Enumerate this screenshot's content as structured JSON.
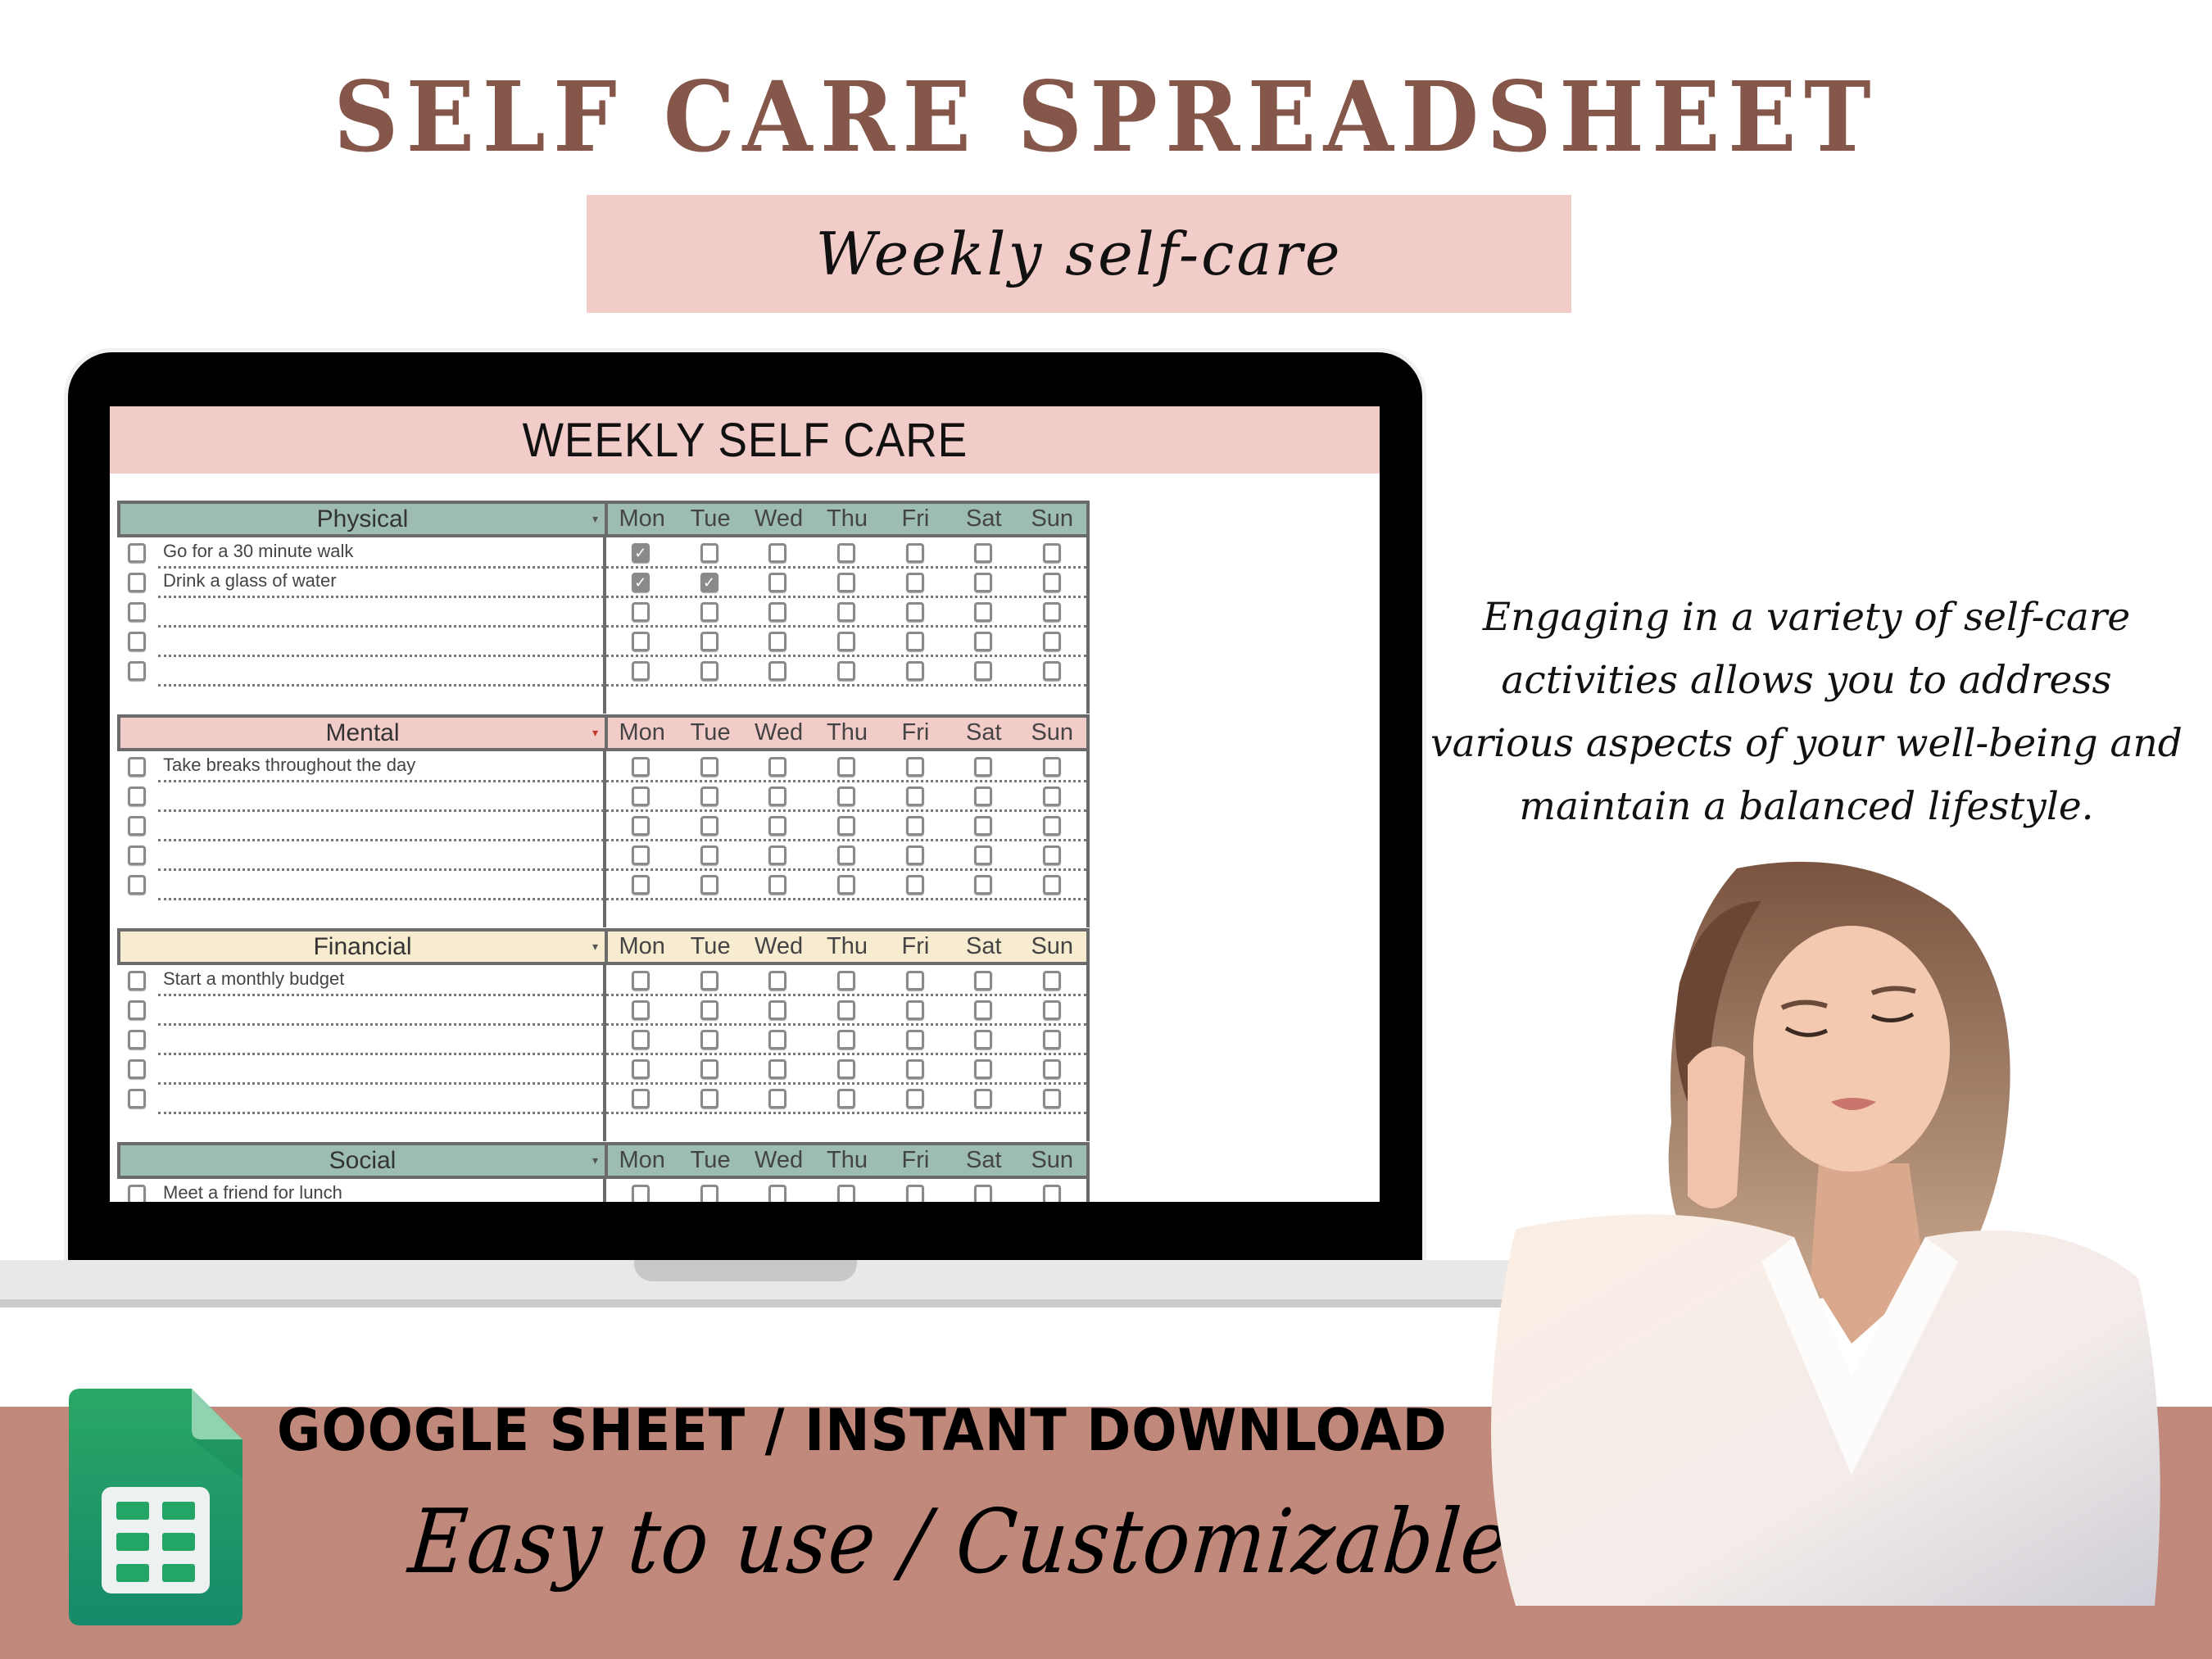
{
  "header": {
    "title": "SELF CARE SPREADSHEET",
    "subtitle": "Weekly self-care"
  },
  "colors": {
    "title_brown": "#85564a",
    "pink": "#f2ccc8",
    "sage": "#9dbdb2",
    "cream": "#f7ebd0",
    "band": "#c0897b",
    "sheets_green": "#23a566"
  },
  "spreadsheet": {
    "title": "WEEKLY SELF CARE",
    "days": [
      "Mon",
      "Tue",
      "Wed",
      "Thu",
      "Fri",
      "Sat",
      "Sun"
    ],
    "sections": [
      {
        "name": "Physical",
        "color": "#9dbdb2",
        "caret_color": "#555555",
        "rows": [
          {
            "task": "Go for a 30 minute walk",
            "done": false,
            "days": [
              true,
              false,
              false,
              false,
              false,
              false,
              false
            ]
          },
          {
            "task": "Drink a glass of water",
            "done": false,
            "days": [
              true,
              true,
              false,
              false,
              false,
              false,
              false
            ]
          },
          {
            "task": "",
            "done": false,
            "days": [
              false,
              false,
              false,
              false,
              false,
              false,
              false
            ]
          },
          {
            "task": "",
            "done": false,
            "days": [
              false,
              false,
              false,
              false,
              false,
              false,
              false
            ]
          },
          {
            "task": "",
            "done": false,
            "days": [
              false,
              false,
              false,
              false,
              false,
              false,
              false
            ]
          }
        ]
      },
      {
        "name": "Mental",
        "color": "#f2ccc8",
        "caret_color": "#c0392b",
        "rows": [
          {
            "task": "Take breaks throughout the day",
            "done": false,
            "days": [
              false,
              false,
              false,
              false,
              false,
              false,
              false
            ]
          },
          {
            "task": "",
            "done": false,
            "days": [
              false,
              false,
              false,
              false,
              false,
              false,
              false
            ]
          },
          {
            "task": "",
            "done": false,
            "days": [
              false,
              false,
              false,
              false,
              false,
              false,
              false
            ]
          },
          {
            "task": "",
            "done": false,
            "days": [
              false,
              false,
              false,
              false,
              false,
              false,
              false
            ]
          },
          {
            "task": "",
            "done": false,
            "days": [
              false,
              false,
              false,
              false,
              false,
              false,
              false
            ]
          }
        ]
      },
      {
        "name": "Financial",
        "color": "#f7ebd0",
        "caret_color": "#555555",
        "rows": [
          {
            "task": "Start a monthly budget",
            "done": false,
            "days": [
              false,
              false,
              false,
              false,
              false,
              false,
              false
            ]
          },
          {
            "task": "",
            "done": false,
            "days": [
              false,
              false,
              false,
              false,
              false,
              false,
              false
            ]
          },
          {
            "task": "",
            "done": false,
            "days": [
              false,
              false,
              false,
              false,
              false,
              false,
              false
            ]
          },
          {
            "task": "",
            "done": false,
            "days": [
              false,
              false,
              false,
              false,
              false,
              false,
              false
            ]
          },
          {
            "task": "",
            "done": false,
            "days": [
              false,
              false,
              false,
              false,
              false,
              false,
              false
            ]
          }
        ]
      },
      {
        "name": "Social",
        "color": "#9dbdb2",
        "caret_color": "#555555",
        "rows": [
          {
            "task": "Meet a friend for lunch",
            "done": false,
            "days": [
              false,
              false,
              false,
              false,
              false,
              false,
              false
            ]
          }
        ]
      }
    ]
  },
  "blurb": "Engaging in a variety of self-care activities allows you to address various aspects of your well-being and maintain a balanced lifestyle.",
  "banner": {
    "line1": "GOOGLE SHEET / INSTANT DOWNLOAD",
    "line2": "Easy to use / Customizable",
    "icon": "google-sheets-icon"
  },
  "illustration": {
    "subject": "woman-in-bathrobe-illustration"
  }
}
